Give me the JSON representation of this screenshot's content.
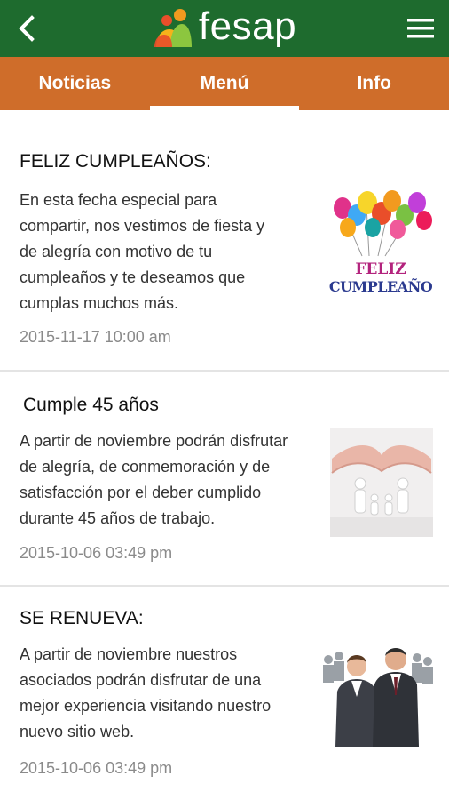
{
  "header": {
    "logo_text": "fesap",
    "colors": {
      "green": "#1e6b2e",
      "orange": "#cf6d2a"
    }
  },
  "tabs": [
    {
      "label": "Noticias",
      "active": false
    },
    {
      "label": "Menú",
      "active": true
    },
    {
      "label": "Info",
      "active": false
    }
  ],
  "news": [
    {
      "title": "FELIZ CUMPLEAÑOS:",
      "lines": [
        "En esta fecha especial para",
        "compartir, nos vestimos de fiesta y",
        "de alegría con motivo de tu",
        "cumpleaños y te deseamos que",
        "cumplas muchos más."
      ],
      "date": "2015-11-17 10:00 am",
      "image_text_1": "FELIZ",
      "image_text_2": "CUMPLEAÑO"
    },
    {
      "title": "Cumple 45 años",
      "lines": [
        "A partir de noviembre podrán disfrutar",
        "de alegría, de conmemoración y de",
        "satisfacción por el deber cumplido",
        "durante 45 años de trabajo."
      ],
      "date": "2015-10-06 03:49 pm"
    },
    {
      "title": "SE RENUEVA:",
      "lines": [
        "A partir de noviembre nuestros",
        "asociados podrán disfrutar de una",
        "mejor experiencia visitando nuestro",
        "nuevo sitio web."
      ],
      "date": "2015-10-06 03:49 pm"
    }
  ]
}
